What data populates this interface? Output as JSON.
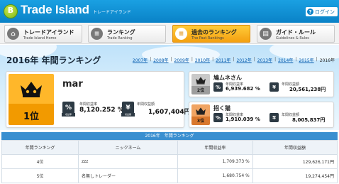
{
  "header": {
    "brand_mark": "B",
    "title": "Trade Island",
    "subtitle": "トレードアイランド",
    "login_icon": "?",
    "login_label": "ログイン"
  },
  "nav": [
    {
      "label": "トレードアイランド",
      "sub": "Trade Island Home",
      "icon": "home-icon",
      "glyph": "⌂",
      "active": false
    },
    {
      "label": "ランキング",
      "sub": "Trade Ranking",
      "icon": "ranking-icon",
      "glyph": "≡",
      "active": false
    },
    {
      "label": "過去のランキング",
      "sub": "The Past Rankings",
      "icon": "past-ranking-icon",
      "glyph": "≡",
      "active": true
    },
    {
      "label": "ガイド・ルール",
      "sub": "Guidelines & Rules",
      "icon": "guide-icon",
      "glyph": "▤",
      "active": false
    }
  ],
  "page_title": "2016年 年間ランキング",
  "years": {
    "links": [
      "2007年",
      "2008年",
      "2009年",
      "2010年",
      "2011年",
      "2012年",
      "2013年",
      "2014年",
      "2015年"
    ],
    "separator": "|",
    "current": "2016年"
  },
  "podium": {
    "first": {
      "rank": "1位",
      "name": "mar",
      "rate_label": "年間収益率",
      "rate": "8,120.252 %",
      "profit_label": "年間収益額",
      "profit": "1,607,404円",
      "rate_tag": "収益率",
      "profit_tag": "収益額"
    },
    "second": {
      "rank": "2位",
      "name": "鳩ムネさん",
      "rate_label": "年間収益率",
      "rate": "6,939.682 %",
      "profit_label": "年間収益額",
      "profit": "20,561,238円"
    },
    "third": {
      "rank": "3位",
      "name": "招く猫",
      "rate_label": "年間収益率",
      "rate": "1,910.039 %",
      "profit_label": "年間収益額",
      "profit": "8,005,837円"
    }
  },
  "table": {
    "title": "2016年　年間ランキング",
    "headers": [
      "年間ランキング",
      "ニックネーム",
      "年間収益率",
      "年間収益額"
    ],
    "rows": [
      [
        "4位",
        "zzz",
        "1,709.373 %",
        "129,626,171円"
      ],
      [
        "5位",
        "名無しトレーダー",
        "1,680.754 %",
        "19,274,454円"
      ]
    ]
  },
  "colors": {
    "header_blue": "#0a82c7",
    "active_tab": "#f4a010",
    "gold": "#f29a00",
    "silver": "#9d9d9d",
    "bronze": "#d9782e"
  }
}
